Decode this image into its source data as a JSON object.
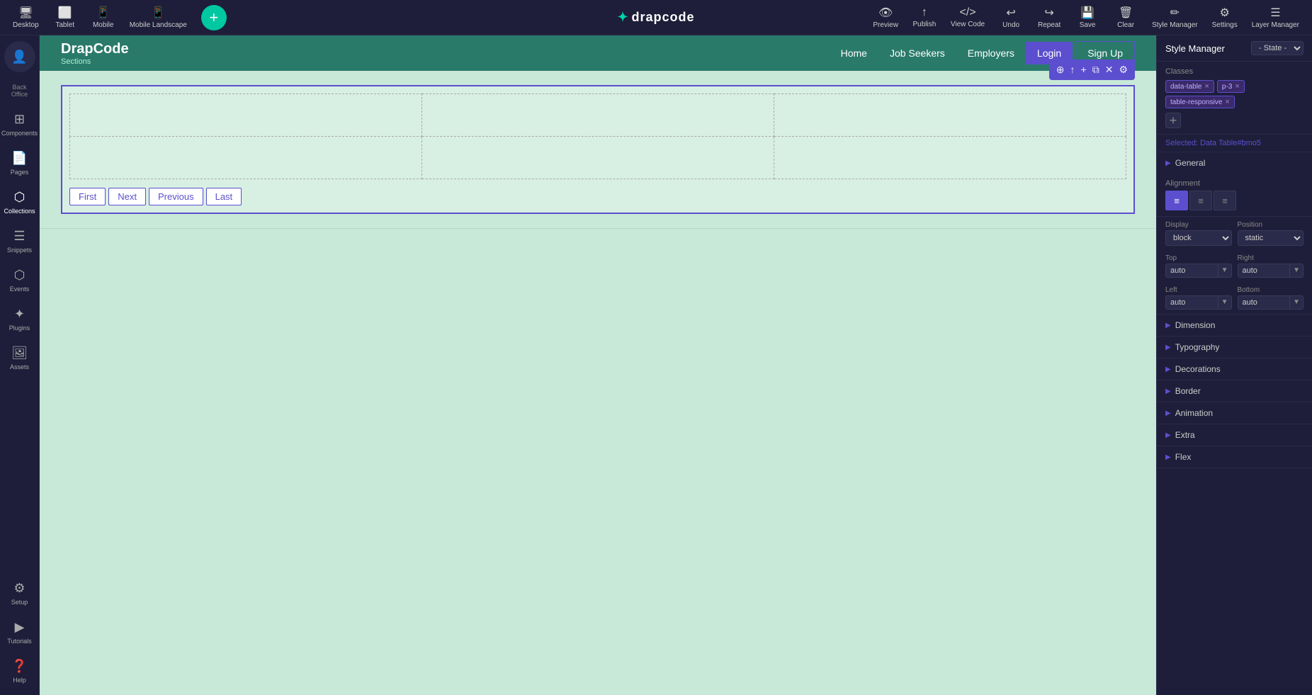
{
  "app": {
    "logo": "drapcode",
    "logo_symbol": "✦"
  },
  "toolbar": {
    "items": [
      {
        "id": "desktop",
        "icon": "🖥",
        "label": "Desktop"
      },
      {
        "id": "tablet",
        "icon": "⬛",
        "label": "Tablet"
      },
      {
        "id": "mobile",
        "icon": "📱",
        "label": "Mobile"
      },
      {
        "id": "mobile-landscape",
        "icon": "📱",
        "label": "Mobile Landscape"
      }
    ],
    "add_icon": "+",
    "right_items": [
      {
        "id": "preview",
        "icon": "👁",
        "label": "Preview"
      },
      {
        "id": "publish",
        "icon": "📤",
        "label": "Publish"
      },
      {
        "id": "view-code",
        "icon": "⟨⟩",
        "label": "View Code"
      },
      {
        "id": "undo",
        "icon": "↩",
        "label": "Undo"
      },
      {
        "id": "repeat",
        "icon": "↪",
        "label": "Repeat"
      },
      {
        "id": "save",
        "icon": "💾",
        "label": "Save"
      },
      {
        "id": "clear",
        "icon": "🗑",
        "label": "Clear"
      },
      {
        "id": "style-manager",
        "icon": "🎨",
        "label": "Style Manager"
      },
      {
        "id": "settings",
        "icon": "⚙",
        "label": "Settings"
      },
      {
        "id": "layer-manager",
        "icon": "☰",
        "label": "Layer Manager"
      }
    ]
  },
  "left_sidebar": {
    "items": [
      {
        "id": "back-office",
        "icon": "👤",
        "label": "Back Office"
      },
      {
        "id": "components",
        "icon": "⊞",
        "label": "Components"
      },
      {
        "id": "pages",
        "icon": "📄",
        "label": "Pages"
      },
      {
        "id": "collections",
        "icon": "⬡",
        "label": "Collections"
      },
      {
        "id": "snippets",
        "icon": "☰",
        "label": "Snippets"
      },
      {
        "id": "events",
        "icon": "⬡",
        "label": "Events"
      },
      {
        "id": "plugins",
        "icon": "✦",
        "label": "Plugins"
      },
      {
        "id": "assets",
        "icon": "🖼",
        "label": "Assets"
      },
      {
        "id": "setup",
        "icon": "⚙",
        "label": "Setup"
      },
      {
        "id": "tutorials",
        "icon": "▶",
        "label": "Tutorials"
      },
      {
        "id": "help",
        "icon": "❓",
        "label": "Help"
      }
    ]
  },
  "canvas": {
    "header": {
      "brand": "DrapCode",
      "brand_sub": "Sections",
      "nav_items": [
        {
          "id": "home",
          "label": "Home",
          "active": false
        },
        {
          "id": "job-seekers",
          "label": "Job Seekers",
          "active": false
        },
        {
          "id": "employers",
          "label": "Employers",
          "active": false
        },
        {
          "id": "login",
          "label": "Login",
          "active": true
        },
        {
          "id": "signup",
          "label": "Sign Up",
          "active": false
        }
      ]
    },
    "element_toolbar": {
      "buttons": [
        "⊕",
        "↑",
        "+",
        "⧉",
        "✕",
        "⚙"
      ]
    },
    "table": {
      "rows": 2,
      "cols": 3
    },
    "pagination": {
      "buttons": [
        "First",
        "Next",
        "Previous",
        "Last"
      ]
    }
  },
  "right_panel": {
    "title": "Style Manager",
    "state_label": "- State -",
    "classes_label": "Classes",
    "class_tags": [
      {
        "label": "data-table",
        "removable": true
      },
      {
        "label": "p-3",
        "removable": true
      },
      {
        "label": "table-responsive",
        "removable": true
      }
    ],
    "selected_label": "Selected:",
    "selected_value": "Data Table#bmo5",
    "sections": [
      {
        "id": "general",
        "label": "General",
        "expanded": true
      },
      {
        "id": "alignment",
        "label": "Alignment",
        "expanded": true
      },
      {
        "id": "display",
        "label": "Display",
        "value": "block"
      },
      {
        "id": "position",
        "label": "Position",
        "value": "static"
      },
      {
        "id": "top",
        "label": "Top",
        "value": "auto"
      },
      {
        "id": "right",
        "label": "Right",
        "value": "auto"
      },
      {
        "id": "left",
        "label": "Left",
        "value": "auto"
      },
      {
        "id": "bottom",
        "label": "Bottom",
        "value": "auto"
      },
      {
        "id": "dimension",
        "label": "Dimension",
        "expanded": false
      },
      {
        "id": "typography",
        "label": "Typography",
        "expanded": false
      },
      {
        "id": "decorations",
        "label": "Decorations",
        "expanded": false
      },
      {
        "id": "border",
        "label": "Border",
        "expanded": false
      },
      {
        "id": "animation",
        "label": "Animation",
        "expanded": false
      },
      {
        "id": "extra",
        "label": "Extra",
        "expanded": false
      },
      {
        "id": "flex",
        "label": "Flex",
        "expanded": false
      }
    ]
  }
}
